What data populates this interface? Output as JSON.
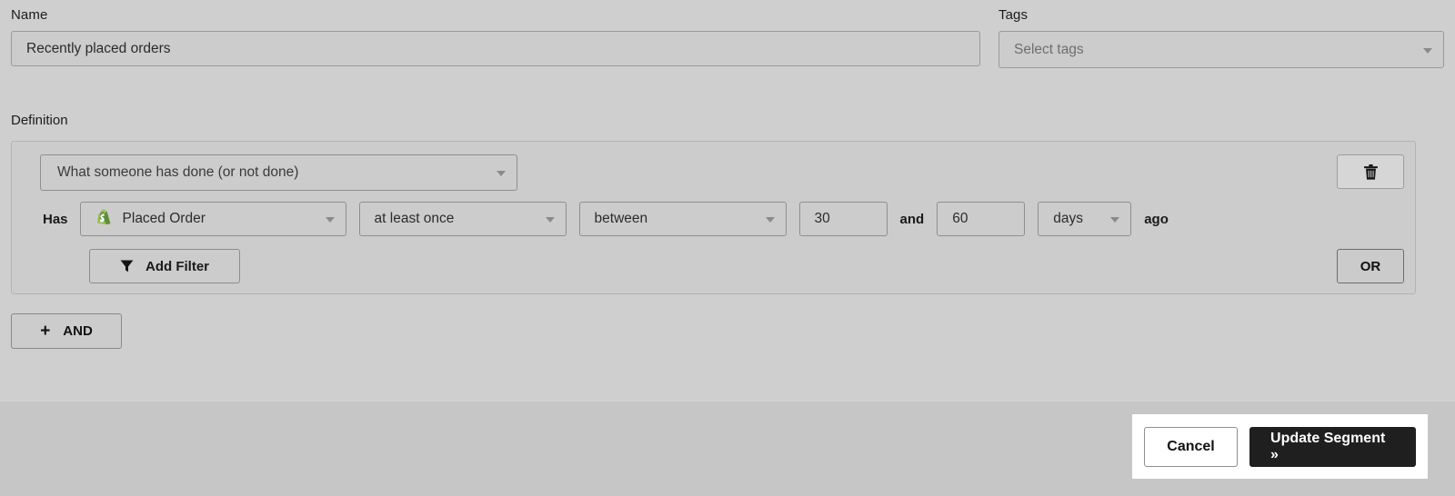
{
  "name_field": {
    "label": "Name",
    "value": "Recently placed orders"
  },
  "tags_field": {
    "label": "Tags",
    "placeholder": "Select tags"
  },
  "definition": {
    "label": "Definition",
    "type_select": {
      "value": "What someone has done (or not done)"
    },
    "filter_row": {
      "has_label": "Has",
      "metric_icon": "shopify-icon",
      "metric": "Placed Order",
      "frequency": "at least once",
      "window": "between",
      "value_from": "30",
      "conjunction": "and",
      "value_to": "60",
      "unit": "days",
      "suffix": "ago"
    },
    "add_filter_button": {
      "icon": "funnel-icon",
      "label": "Add Filter"
    },
    "delete_button": {
      "icon": "trash-icon"
    },
    "or_button": {
      "label": "OR"
    }
  },
  "and_button": {
    "icon": "plus-icon",
    "plus": "+",
    "label": "AND"
  },
  "footer": {
    "cancel_label": "Cancel",
    "update_label": "Update Segment »"
  },
  "colors": {
    "page_background": "#cfcfcf",
    "panel_background": "#cccccc",
    "footer_background": "#c6c6c6",
    "primary_button": "#1f1f1f",
    "shopify_green": "#95bf47",
    "shopify_green_dark": "#5e8e3e",
    "text": "#1a1a1a",
    "placeholder_text": "#6e6e6e"
  }
}
